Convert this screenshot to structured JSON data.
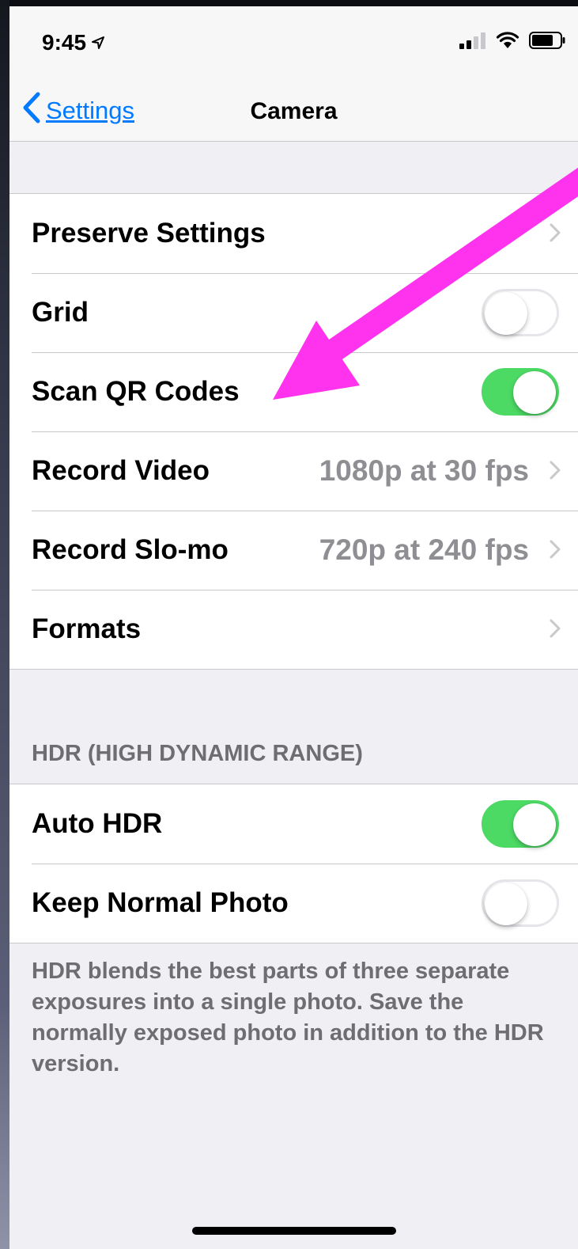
{
  "status_bar": {
    "time": "9:45",
    "location_icon": "location-arrow-icon",
    "signal_icon": "cellular-signal-icon",
    "wifi_icon": "wifi-icon",
    "battery_icon": "battery-icon"
  },
  "nav": {
    "back_label": "Settings",
    "title": "Camera",
    "accent_color": "#007aff"
  },
  "main_group": {
    "rows": [
      {
        "label": "Preserve Settings",
        "type": "disclosure"
      },
      {
        "label": "Grid",
        "type": "toggle",
        "on": false
      },
      {
        "label": "Scan QR Codes",
        "type": "toggle",
        "on": true
      },
      {
        "label": "Record Video",
        "type": "disclosure",
        "value": "1080p at 30 fps"
      },
      {
        "label": "Record Slo-mo",
        "type": "disclosure",
        "value": "720p at 240 fps"
      },
      {
        "label": "Formats",
        "type": "disclosure"
      }
    ]
  },
  "hdr_section": {
    "header": "HDR (HIGH DYNAMIC RANGE)",
    "rows": [
      {
        "label": "Auto HDR",
        "type": "toggle",
        "on": true
      },
      {
        "label": "Keep Normal Photo",
        "type": "toggle",
        "on": false
      }
    ],
    "footer": "HDR blends the best parts of three separate exposures into a single photo. Save the normally exposed photo in addition to the HDR version."
  },
  "colors": {
    "toggle_on": "#4cd964",
    "annotation_arrow": "#ff33ee"
  }
}
